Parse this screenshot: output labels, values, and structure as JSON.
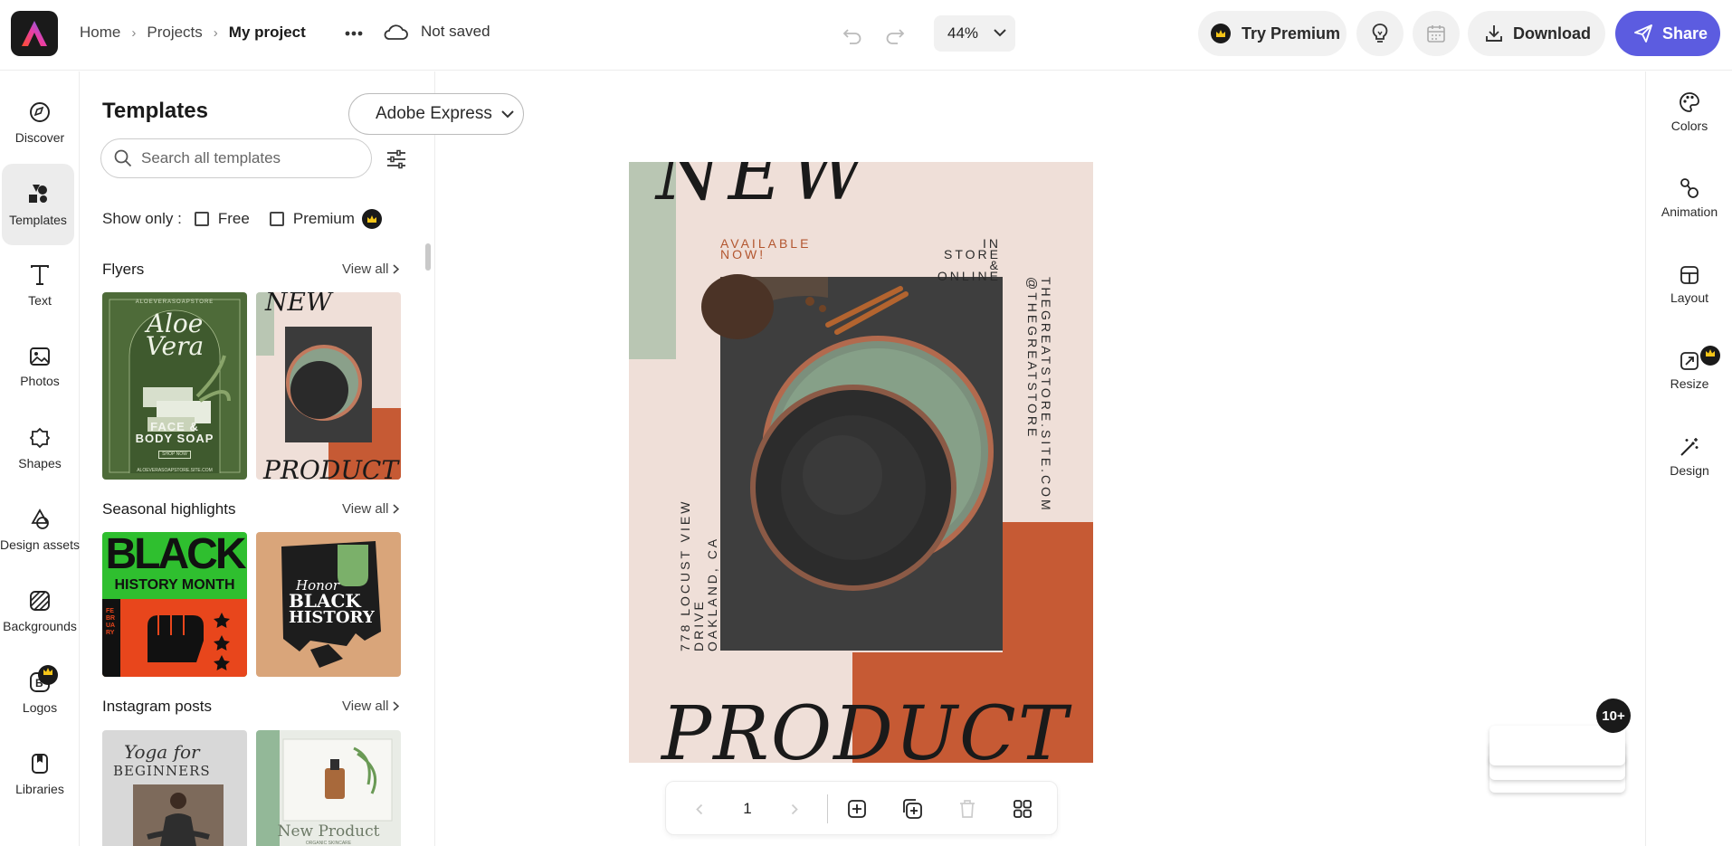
{
  "breadcrumb": {
    "home": "Home",
    "projects": "Projects",
    "current": "My project"
  },
  "save_status": "Not saved",
  "zoom_level": "44%",
  "toolbar": {
    "try_premium": "Try Premium",
    "download": "Download",
    "share": "Share"
  },
  "left_rail": [
    {
      "label": "Discover",
      "icon": "compass-icon"
    },
    {
      "label": "Templates",
      "icon": "templates-icon",
      "active": true
    },
    {
      "label": "Text",
      "icon": "text-icon"
    },
    {
      "label": "Photos",
      "icon": "photos-icon"
    },
    {
      "label": "Shapes",
      "icon": "shapes-icon"
    },
    {
      "label": "Design assets",
      "icon": "design-assets-icon"
    },
    {
      "label": "Backgrounds",
      "icon": "backgrounds-icon"
    },
    {
      "label": "Logos",
      "icon": "logos-icon",
      "premium": true
    },
    {
      "label": "Libraries",
      "icon": "libraries-icon"
    }
  ],
  "panel": {
    "title": "Templates",
    "source_dropdown": "Adobe Express",
    "search_placeholder": "Search all templates",
    "show_only_label": "Show only :",
    "filter_free": "Free",
    "filter_premium": "Premium",
    "view_all": "View all",
    "sections": [
      {
        "title": "Flyers"
      },
      {
        "title": "Seasonal highlights"
      },
      {
        "title": "Instagram posts"
      }
    ],
    "thumbs": {
      "aloe_top": "ALOEVERASOAPSTORE",
      "aloe_title_1": "Aloe",
      "aloe_title_2": "Vera",
      "aloe_sub_1": "FACE &",
      "aloe_sub_2": "BODY SOAP",
      "aloe_cta": "SHOP NOW",
      "aloe_url": "ALOEVERASOAPSTORE.SITE.COM",
      "flyer2_top": "NEW",
      "flyer2_bottom": "PRODUCT",
      "bh_black": "BLACK",
      "bh_month": "HISTORY MONTH",
      "bh_feb": "FEBRUARY",
      "honor_honor": "Honor",
      "honor_black": "BLACK",
      "honor_history": "HISTORY",
      "yoga_1": "Yoga for",
      "yoga_2": "BEGINNERS",
      "np_title": "New Product",
      "np_sub": "ORGANIC SKINCARE"
    }
  },
  "poster": {
    "headline": "NEW",
    "available": "AVAILABLE\nNOW!",
    "instore": "IN STORE\n& ONLINE",
    "address_1": "778 LOCUST VIEW DRIVE",
    "address_2": "OAKLAND, CA",
    "website_1": "THEGREATSTORE.SITE.COM",
    "website_2": "@THEGREATSTORE",
    "footer": "PRODUCT"
  },
  "pager": {
    "page": "1"
  },
  "right_rail": [
    {
      "label": "Colors",
      "icon": "palette-icon"
    },
    {
      "label": "Animation",
      "icon": "animation-icon"
    },
    {
      "label": "Layout",
      "icon": "layout-icon"
    },
    {
      "label": "Resize",
      "icon": "resize-icon",
      "premium": true
    },
    {
      "label": "Design",
      "icon": "magic-wand-icon"
    }
  ],
  "pages_badge": "10+",
  "colors": {
    "accent": "#5c5ce0",
    "poster_bg": "#efdfd8",
    "poster_sage": "#b9c6b3",
    "poster_rust": "#c65a34",
    "text_rust": "#b3562f"
  }
}
